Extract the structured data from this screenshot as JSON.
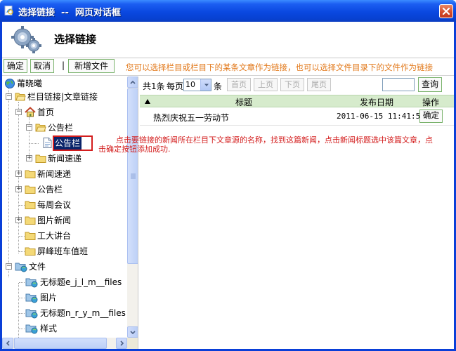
{
  "window": {
    "title": "选择链接  --  网页对话框",
    "banner_title": "选择链接"
  },
  "toolbar": {
    "confirm_label": "确定",
    "cancel_label": "取消",
    "separator": "|",
    "new_file_label": "新增文件",
    "hint": "您可以选择栏目或栏目下的某条文章作为链接，也可以选择文件目录下的文件作为链接"
  },
  "tree": {
    "root": "莆晓曦",
    "section_label": "栏目链接|文章链接",
    "home": "首页",
    "notice": "公告栏",
    "notice_selected": "公告栏",
    "news_express": "新闻速递",
    "top_news_express": "新闻速递",
    "top_notice": "公告栏",
    "weekly_meeting": "每周会议",
    "picture_news": "图片新闻",
    "forum": "工大讲台",
    "bus_schedule": "屏峰班车值班",
    "files": "文件",
    "untitled1": "无标题e_j_l_m__files",
    "images": "图片",
    "untitled2": "无标题n_r_y_m__files",
    "styles": "样式"
  },
  "pager": {
    "total": "共1条",
    "per_page_label": "每页",
    "per_page_value": "10",
    "unit": "条",
    "first": "首页",
    "prev": "上页",
    "next": "下页",
    "last": "尾页",
    "search_label": "查询"
  },
  "table": {
    "headers": {
      "title": "标题",
      "date": "发布日期",
      "action": "操作"
    },
    "rows": [
      {
        "title": "热烈庆祝五一劳动节",
        "date": "2011-06-15 11:41:56",
        "action": "确定"
      }
    ]
  },
  "annotation": {
    "line1": "点击要链接的新闻所在栏目下文章源的名称，找到这篇新闻，点击新闻标题选中该篇文章，点",
    "line2": "击确定按钮添加成功."
  },
  "colors": {
    "title_bar": "#0a48e0",
    "hint_text": "#e2791b",
    "annotation": "#d31d1d",
    "table_header": "#d6ebcc",
    "selection": "#0a246a"
  }
}
